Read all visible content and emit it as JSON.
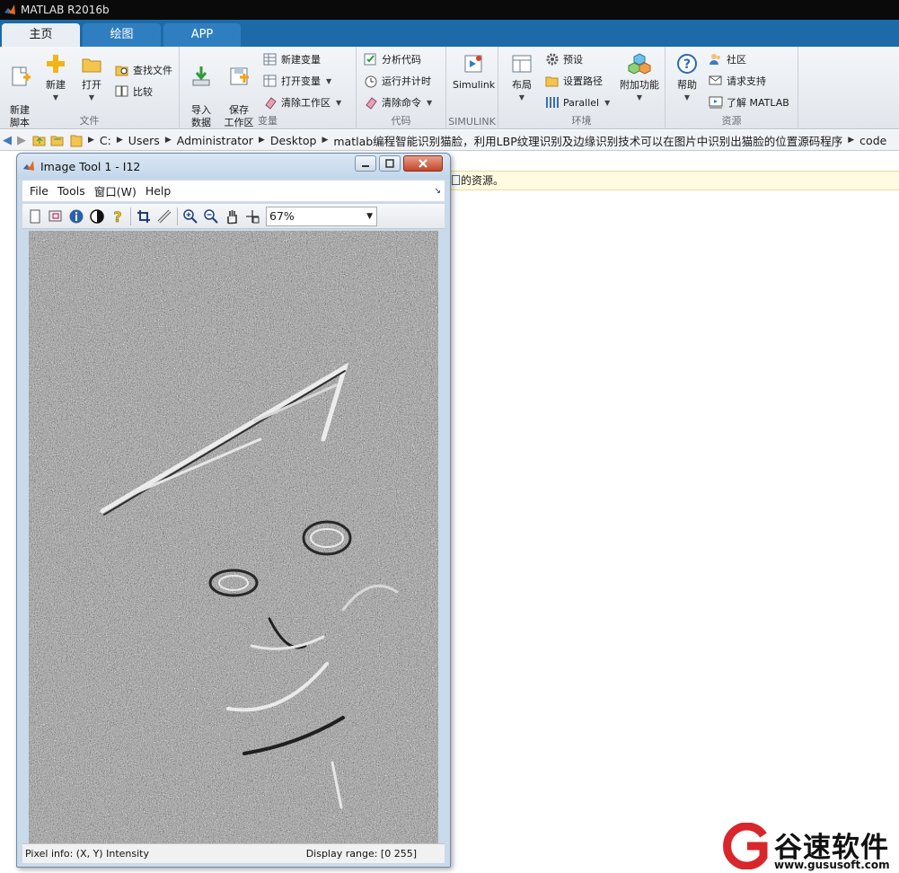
{
  "app": {
    "title": "MATLAB R2016b"
  },
  "tabs": [
    {
      "label": "主页",
      "active": true
    },
    {
      "label": "绘图",
      "active": false
    },
    {
      "label": "APP",
      "active": false
    }
  ],
  "ribbon": {
    "file": {
      "label": "文件",
      "new_script": "新建\n脚本",
      "new": "新建",
      "open": "打开",
      "find_files": "查找文件",
      "compare": "比较"
    },
    "variable": {
      "label": "变量",
      "import_data": "导入\n数据",
      "save_workspace": "保存\n工作区",
      "new_variable": "新建变量",
      "open_variable": "打开变量",
      "clear_workspace": "清除工作区"
    },
    "code": {
      "label": "代码",
      "analyze_code": "分析代码",
      "run_and_time": "运行并计时",
      "clear_commands": "清除命令"
    },
    "simulink": {
      "label": "SIMULINK",
      "simulink": "Simulink"
    },
    "environment": {
      "label": "环境",
      "layout": "布局",
      "preferences": "预设",
      "set_path": "设置路径",
      "parallel": "Parallel",
      "add_ons": "附加功能"
    },
    "resources": {
      "label": "资源",
      "help": "帮助",
      "community": "社区",
      "request_support": "请求支持",
      "learn_matlab": "了解 MATLAB"
    }
  },
  "address": {
    "crumbs": [
      "C:",
      "Users",
      "Administrator",
      "Desktop",
      "matlab编程智能识别猫脸，利用LBP纹理识别及边缘识别技术可以在图片中识别出猫脸的位置源码程序",
      "code"
    ]
  },
  "infobar": {
    "text": "的资源。"
  },
  "image_tool": {
    "title": "Image Tool 1 - I12",
    "menu": {
      "file": "File",
      "tools": "Tools",
      "window": "窗口(W)",
      "help": "Help"
    },
    "zoom": "67%",
    "status_left": "Pixel info: (X, Y)  Intensity",
    "status_right": "Display range: [0 255]"
  },
  "watermark": {
    "text": "谷速软件",
    "url": "www.gususoft.com"
  },
  "colors": {
    "tab_bar": "#1c6aa8",
    "accent": "#2f7fc0",
    "watermark_red": "#d8262b"
  }
}
